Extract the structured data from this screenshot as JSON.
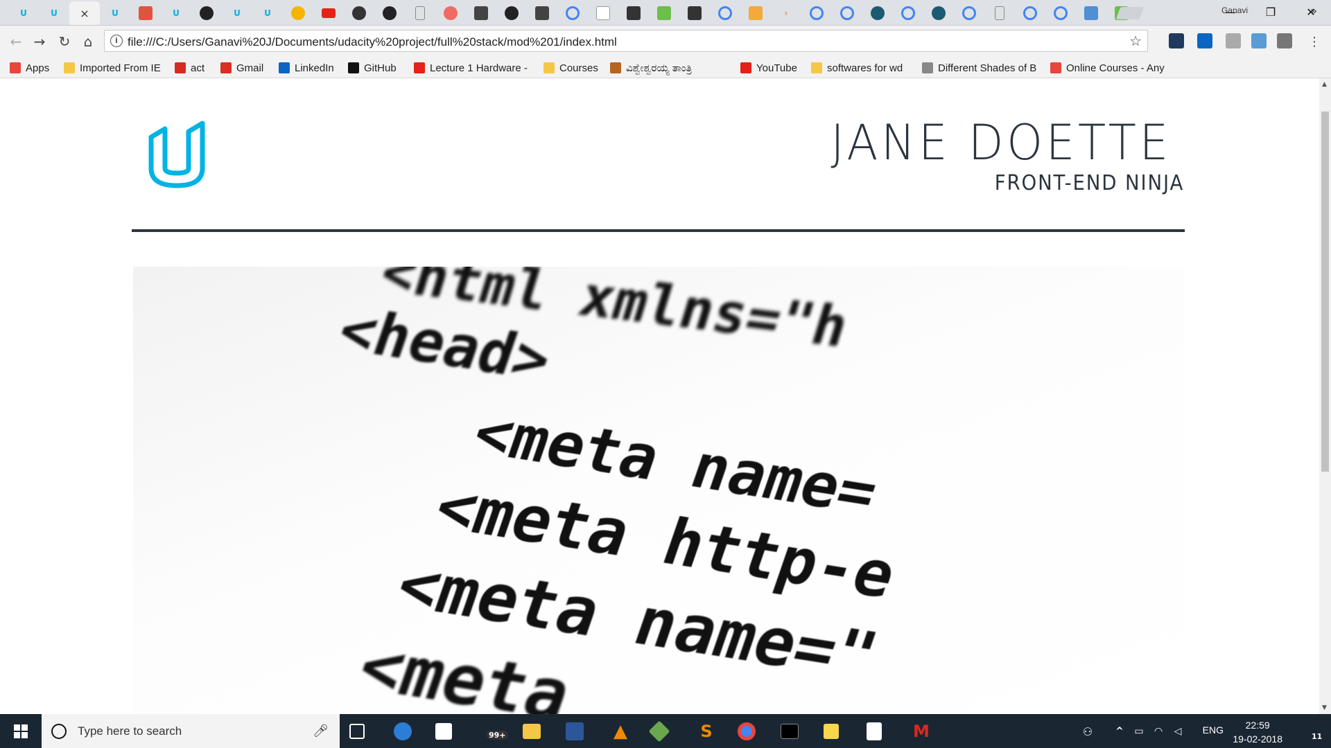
{
  "browser": {
    "profile_name": "Ganavi",
    "url": "file:///C:/Users/Ganavi%20J/Documents/udacity%20project/full%20stack/mod%201/index.html",
    "active_tab_close": "×"
  },
  "bookmarks": [
    {
      "label": "Apps",
      "icon": "apps-grid-icon",
      "color": "#e8453c"
    },
    {
      "label": "Imported From IE",
      "icon": "folder-icon",
      "color": "#f6c744"
    },
    {
      "label": "act",
      "icon": "act-icon",
      "color": "#d62b1f"
    },
    {
      "label": "Gmail",
      "icon": "gmail-icon",
      "color": "#d93025"
    },
    {
      "label": "LinkedIn",
      "icon": "linkedin-icon",
      "color": "#0a66c2"
    },
    {
      "label": "GitHub",
      "icon": "github-icon",
      "color": "#111111"
    },
    {
      "label": "Lecture 1 Hardware -",
      "icon": "youtube-icon",
      "color": "#e62117"
    },
    {
      "label": "Courses",
      "icon": "folder-icon",
      "color": "#f6c744"
    },
    {
      "label": "ವಿಶ್ವೇಶ್ವರಯ್ಯ ತಾಂತ್ರಿ",
      "icon": "emblem-icon",
      "color": "#b5651d"
    },
    {
      "label": "YouTube",
      "icon": "youtube-icon",
      "color": "#e62117"
    },
    {
      "label": "softwares  for wd",
      "icon": "folder-icon",
      "color": "#f6c744"
    },
    {
      "label": "Different Shades of B",
      "icon": "page-icon",
      "color": "#888888"
    },
    {
      "label": "Online Courses - Any",
      "icon": "udemy-icon",
      "color": "#e8453c"
    }
  ],
  "page": {
    "name": "JANE DOETTE",
    "role": "FRONT-END NINJA",
    "logo": "udacity-logo-icon",
    "logo_color": "#02b3e4",
    "text_color": "#2b3540",
    "hero_code_lines": [
      {
        "text": "<html   xmlns=\"h"
      },
      {
        "text": "<head>"
      },
      {
        "text": "<meta   name="
      },
      {
        "text": "<meta   http-e"
      },
      {
        "text": "<meta   name=\""
      },
      {
        "text": "<meta"
      }
    ]
  },
  "taskbar": {
    "search_placeholder": "Type here to search",
    "mail_badge": "99+",
    "language": "ENG",
    "time": "22:59",
    "date": "19-02-2018",
    "notifications": "11"
  }
}
